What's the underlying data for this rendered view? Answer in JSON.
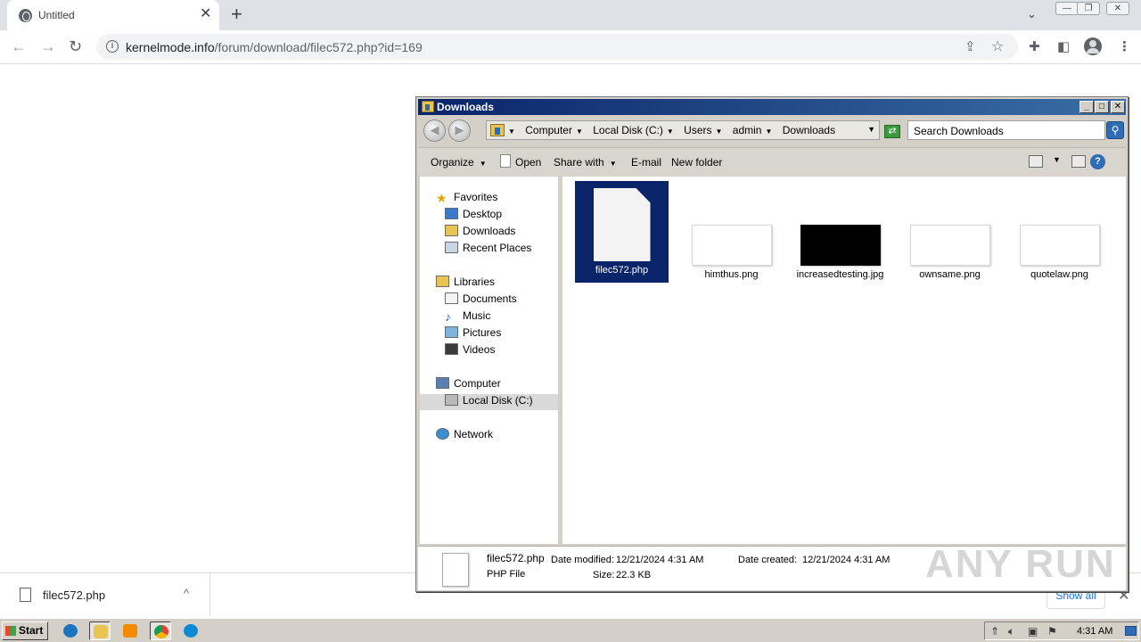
{
  "browser": {
    "tab_title": "Untitled",
    "tab_close": "✕",
    "new_tab": "+",
    "tab_search": "⌄",
    "window_controls": [
      "—",
      "❐",
      "✕"
    ],
    "nav": {
      "back": "←",
      "forward": "→",
      "reload": "↻"
    },
    "url_domain": "kernelmode.info",
    "url_path": "/forum/download/filec572.php?id=169",
    "omnibox_icons": {
      "info": "i",
      "share": "⇪",
      "bookmark": "☆"
    },
    "toolbar_icons": {
      "extensions": "✚",
      "sidepanel": "◧",
      "menu": "⋮"
    }
  },
  "download_bar": {
    "filename": "filec572.php",
    "chevron": "^",
    "show_all": "Show all",
    "close": "✕"
  },
  "explorer": {
    "title": "Downloads",
    "title_buttons": [
      "_",
      "□",
      "✕"
    ],
    "nav_buttons": {
      "back": "◀",
      "forward": "▶"
    },
    "breadcrumbs": [
      "Computer",
      "Local Disk (C:)",
      "Users",
      "admin",
      "Downloads"
    ],
    "refresh_icon": "⇄",
    "search_placeholder": "Search Downloads",
    "search_icon": "⚲",
    "commands": {
      "organize": "Organize",
      "open": "Open",
      "share_with": "Share with",
      "email": "E-mail",
      "new_folder": "New folder",
      "help": "?"
    },
    "nav_pane": {
      "favorites": "Favorites",
      "desktop": "Desktop",
      "downloads": "Downloads",
      "recent_places": "Recent Places",
      "libraries": "Libraries",
      "documents": "Documents",
      "music": "Music",
      "pictures": "Pictures",
      "videos": "Videos",
      "computer": "Computer",
      "local_disk": "Local Disk (C:)",
      "network": "Network"
    },
    "files": [
      {
        "name": "filec572.php",
        "selected": true
      },
      {
        "name": "himthus.png"
      },
      {
        "name": "increasedtesting.jpg"
      },
      {
        "name": "ownsame.png"
      },
      {
        "name": "quotelaw.png"
      }
    ],
    "details": {
      "filename": "filec572.php",
      "type": "PHP File",
      "date_modified_label": "Date modified:",
      "date_modified": "12/21/2024 4:31 AM",
      "size_label": "Size:",
      "size": "22.3 KB",
      "date_created_label": "Date created:",
      "date_created": "12/21/2024 4:31 AM"
    }
  },
  "watermark": "ANY RUN",
  "taskbar": {
    "start": "Start",
    "clock": "4:31 AM",
    "colors": {
      "ie": "#1e73be",
      "explorer": "#e8c454",
      "media": "#f28b00",
      "chrome": "#db4437",
      "edge": "#0c8ad6"
    }
  }
}
